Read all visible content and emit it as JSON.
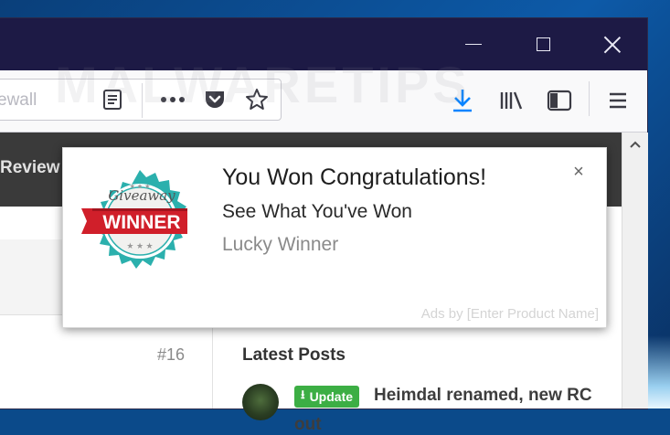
{
  "browser": {
    "url_partial": "ewall",
    "window_controls": {
      "minimize_icon": "minimize-icon",
      "maximize_icon": "maximize-icon",
      "close_icon": "close-icon"
    }
  },
  "page": {
    "nav_label": "Review",
    "post_number": "#16",
    "sidebar": {
      "section_title": "Latest Posts",
      "post": {
        "badge_label": "Update",
        "title_line1": "Heimdal renamed, new RC",
        "title_line2": "out"
      }
    }
  },
  "watermark": {
    "text_top": "MALWARETIPS",
    "text_mid": "MALWARETIPS"
  },
  "notification": {
    "title": "You Won Congratulations!",
    "body": "See What You've Won",
    "subtitle": "Lucky Winner",
    "ads_label": "Ads by [Enter Product Name]",
    "close_glyph": "×",
    "badge": {
      "script_text": "Giveaway",
      "main_text": "WINNER",
      "accent_color": "#2bb0ad",
      "ribbon_color": "#d01f2a"
    }
  },
  "colors": {
    "titlebar": "#1d1a45",
    "download_blue": "#0a84ff",
    "update_green": "#3cae44"
  }
}
